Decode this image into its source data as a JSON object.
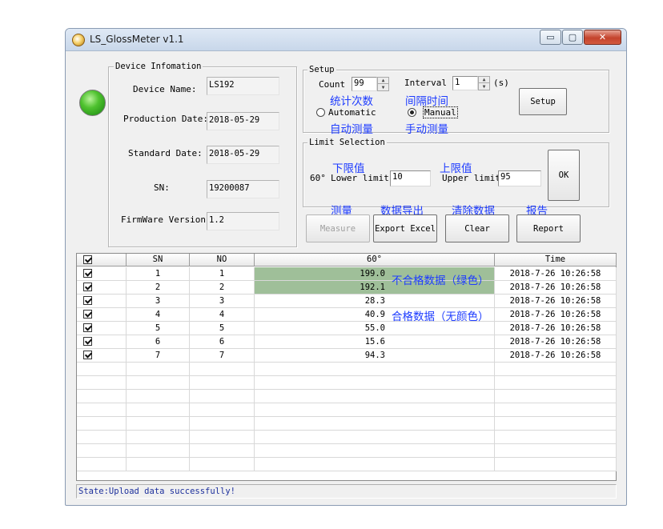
{
  "window": {
    "title": "LS_GlossMeter v1.1",
    "minimize": "▭",
    "maximize": "▢",
    "close": "✕"
  },
  "device_info": {
    "legend": "Device Infomation",
    "device_name_label": "Device Name:",
    "device_name": "LS192",
    "production_date_label": "Production Date:",
    "production_date": "2018-05-29",
    "standard_date_label": "Standard Date:",
    "standard_date": "2018-05-29",
    "sn_label": "SN:",
    "sn": "19200087",
    "firmware_label": "FirmWare Version:",
    "firmware": "1.2"
  },
  "setup": {
    "legend": "Setup",
    "count_label": "Count",
    "count": "99",
    "interval_label": "Interval",
    "interval": "1",
    "interval_unit": "(s)",
    "automatic_label": "Automatic",
    "manual_label": "Manual",
    "mode": "manual",
    "setup_button": "Setup"
  },
  "limit": {
    "legend": "Limit Selection",
    "angle": "60°",
    "lower_label": "Lower limit",
    "lower": "10",
    "upper_label": "Upper limit",
    "upper": "95",
    "ok_button": "OK"
  },
  "actions": {
    "measure": "Measure",
    "export": "Export Excel",
    "clear": "Clear",
    "report": "Report"
  },
  "annotations": {
    "count": "统计次数",
    "interval": "间隔时间",
    "automatic": "自动测量",
    "manual": "手动测量",
    "lower": "下限值",
    "upper": "上限值",
    "measure": "测量",
    "export": "数据导出",
    "clear": "清除数据",
    "report": "报告",
    "fail_data": "不合格数据（绿色）",
    "pass_data": "合格数据（无颜色）"
  },
  "table": {
    "columns": [
      "SN",
      "NO",
      "60°",
      "Time"
    ],
    "rows": [
      {
        "sn": "1",
        "no": "1",
        "value": "199.0",
        "time": "2018-7-26 10:26:58",
        "fail": true
      },
      {
        "sn": "2",
        "no": "2",
        "value": "192.1",
        "time": "2018-7-26 10:26:58",
        "fail": true
      },
      {
        "sn": "3",
        "no": "3",
        "value": "28.3",
        "time": "2018-7-26 10:26:58",
        "fail": false
      },
      {
        "sn": "4",
        "no": "4",
        "value": "40.9",
        "time": "2018-7-26 10:26:58",
        "fail": false
      },
      {
        "sn": "5",
        "no": "5",
        "value": "55.0",
        "time": "2018-7-26 10:26:58",
        "fail": false
      },
      {
        "sn": "6",
        "no": "6",
        "value": "15.6",
        "time": "2018-7-26 10:26:58",
        "fail": false
      },
      {
        "sn": "7",
        "no": "7",
        "value": "94.3",
        "time": "2018-7-26 10:26:58",
        "fail": false
      }
    ],
    "fail_color": "#9fbf99"
  },
  "status": "State:Upload data successfully!",
  "indicator_color": "#2e9e1c"
}
